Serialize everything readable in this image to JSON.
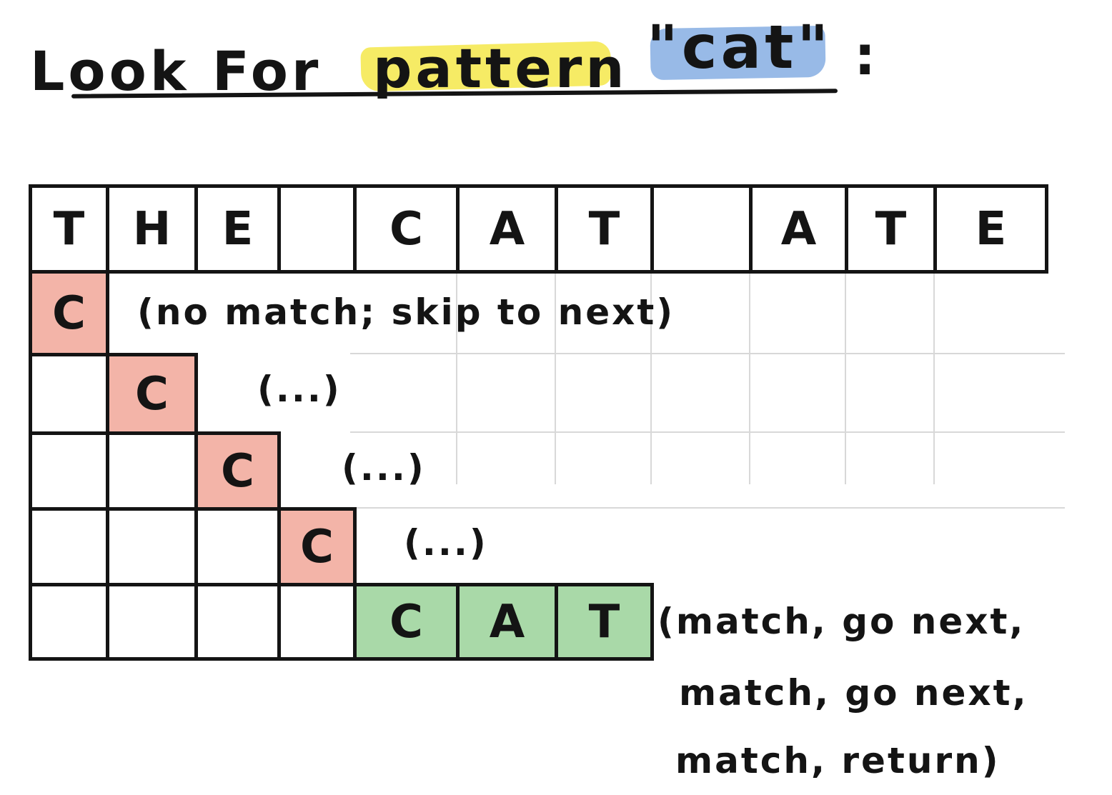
{
  "title": {
    "lead": "Look For",
    "highlight": "pattern",
    "pattern": "\"cat\"",
    "colon": ":"
  },
  "colors": {
    "ink": "#141414",
    "mismatch": "#f3b4a8",
    "match": "#a9d9a8",
    "highlight_yellow": "#f4e84a",
    "highlight_blue": "#86aee3"
  },
  "text_row": [
    "T",
    "H",
    "E",
    "",
    "C",
    "A",
    "T",
    "",
    "A",
    "T",
    "E"
  ],
  "attempts": [
    {
      "chars": [
        "C"
      ],
      "status": "mismatch",
      "note": "(no match; skip to next)"
    },
    {
      "chars": [
        "C"
      ],
      "status": "mismatch",
      "note": "(...)"
    },
    {
      "chars": [
        "C"
      ],
      "status": "mismatch",
      "note": "(...)"
    },
    {
      "chars": [
        "C"
      ],
      "status": "mismatch",
      "note": "(...)"
    },
    {
      "chars": [
        "C",
        "A",
        "T"
      ],
      "status": "match"
    }
  ],
  "match_note": [
    "(match, go next,",
    "match, go next,",
    "match, return)"
  ]
}
